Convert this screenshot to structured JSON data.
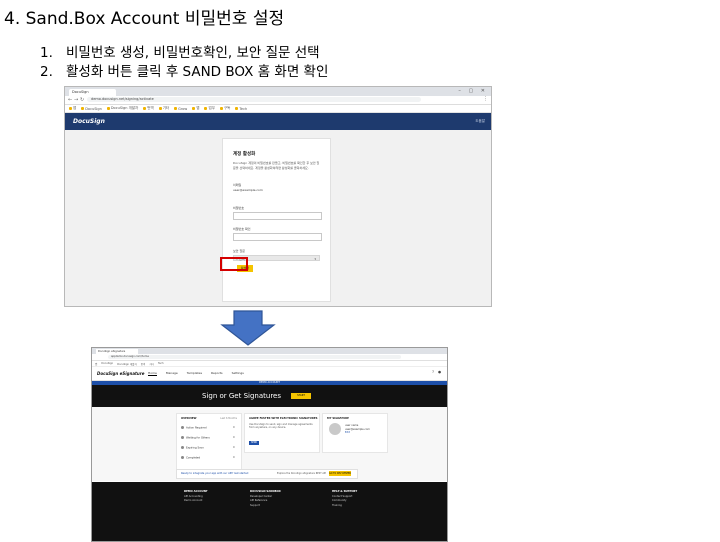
{
  "slide": {
    "title": "4. Sand.Box Account 비밀번호 설정",
    "steps": [
      {
        "num": "1.",
        "text": "비밀번호 생성, 비밀번호확인, 보안 질문 선택"
      },
      {
        "num": "2.",
        "text": "활성화 버튼 클릭 후 SAND BOX 홈 화면 확인"
      }
    ]
  },
  "shot1": {
    "tab_title": "DocuSign",
    "url": "demo.docusign.net/signing/activate",
    "bookmarks": [
      "앱",
      "DocuSign",
      "DocuSign 개발자",
      "번역",
      "기타",
      "Grow",
      "앱",
      "업무",
      "구독",
      "Tech"
    ],
    "logo": "DocuSign",
    "header_right": "도움말",
    "card": {
      "title": "계정 활성화",
      "body": "DocuSign 계정의 비밀번호를 만들고, 비밀번호를 확인한 후 보안 질문을 선택하세요. 계정을 활성화하려면 활성화를 클릭하세요.",
      "email_label": "이메일",
      "email_value": "user@example.com",
      "password_label": "비밀번호",
      "confirm_label": "비밀번호 확인",
      "question_label": "보안 질문",
      "question_value": "-- 선택 --",
      "activate_label": "활성화"
    }
  },
  "shot2": {
    "tab_title": "DocuSign eSignature",
    "url": "appdemo.docusign.com/home",
    "bookmarks": [
      "앱",
      "DocuSign",
      "DocuSign 개발자",
      "번역",
      "기타",
      "Tech"
    ],
    "logo": "DocuSign eSignature",
    "nav": [
      "Home",
      "Manage",
      "Templates",
      "Reports",
      "Settings"
    ],
    "banner": "DEMO ACCOUNT",
    "hero_text": "Sign or Get Signatures",
    "hero_button": "START",
    "overview": {
      "header": "OVERVIEW",
      "header_right": "Last 6 Months",
      "rows": [
        {
          "label": "Action Required",
          "count": "0"
        },
        {
          "label": "Waiting for Others",
          "count": "0"
        },
        {
          "label": "Expiring Soon",
          "count": "0"
        },
        {
          "label": "Completed",
          "count": "0"
        }
      ]
    },
    "agreements": {
      "header": "AGREE FASTER WITH ELECTRONIC SIGNATURES",
      "text": "Use DocuSign to send, sign and manage agreements from anywhere, on any device.",
      "button": "SEND"
    },
    "signature": {
      "header": "MY SIGNATURE",
      "user_name": "user name",
      "user_email": "user@example.com",
      "edit": "Edit"
    },
    "strip": {
      "left": "Ready to integrate your app with our API? Get started",
      "right": "Explore the DocuSign eSignature REST API",
      "button": "GO TO DEV CENTER"
    },
    "footer": {
      "col1": [
        "DEMO ACCOUNT",
        "API Accounting",
        "Demo Account"
      ],
      "col2": [
        "DOCUSIGN SANDBOX",
        "Developer Center",
        "API Reference",
        "Support"
      ],
      "col3": [
        "HELP & SUPPORT",
        "Contact Support",
        "Community",
        "Training"
      ]
    }
  }
}
